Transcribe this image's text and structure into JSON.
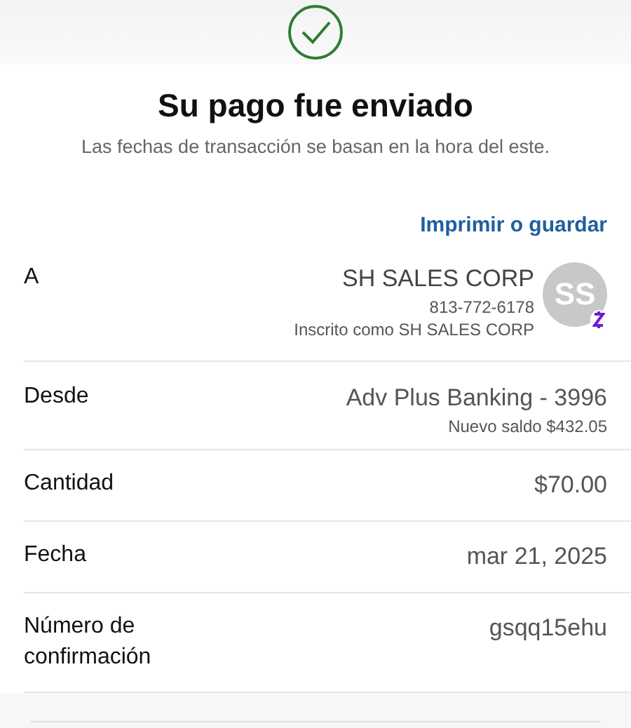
{
  "header": {
    "title": "Su pago fue enviado",
    "subtitle": "Las fechas de transacción se basan en la hora del este.",
    "link": "Imprimir o guardar"
  },
  "rows": [
    {
      "kind": "payee",
      "label": "A",
      "value": "SH SALES CORP",
      "lines": [
        "813-772-6178",
        "Inscrito como SH SALES CORP"
      ],
      "initials": "SS"
    },
    {
      "kind": "account",
      "label": "Desde",
      "value": "Adv Plus Banking - 3996",
      "lines": [
        "Nuevo saldo $432.05"
      ]
    },
    {
      "kind": "plain",
      "label": "Cantidad",
      "value": "$70.00"
    },
    {
      "kind": "plain",
      "label": "Fecha",
      "value": "mar 21, 2025"
    },
    {
      "kind": "plain",
      "label": "Número de confirmación",
      "value": "gsqq15ehu"
    }
  ]
}
